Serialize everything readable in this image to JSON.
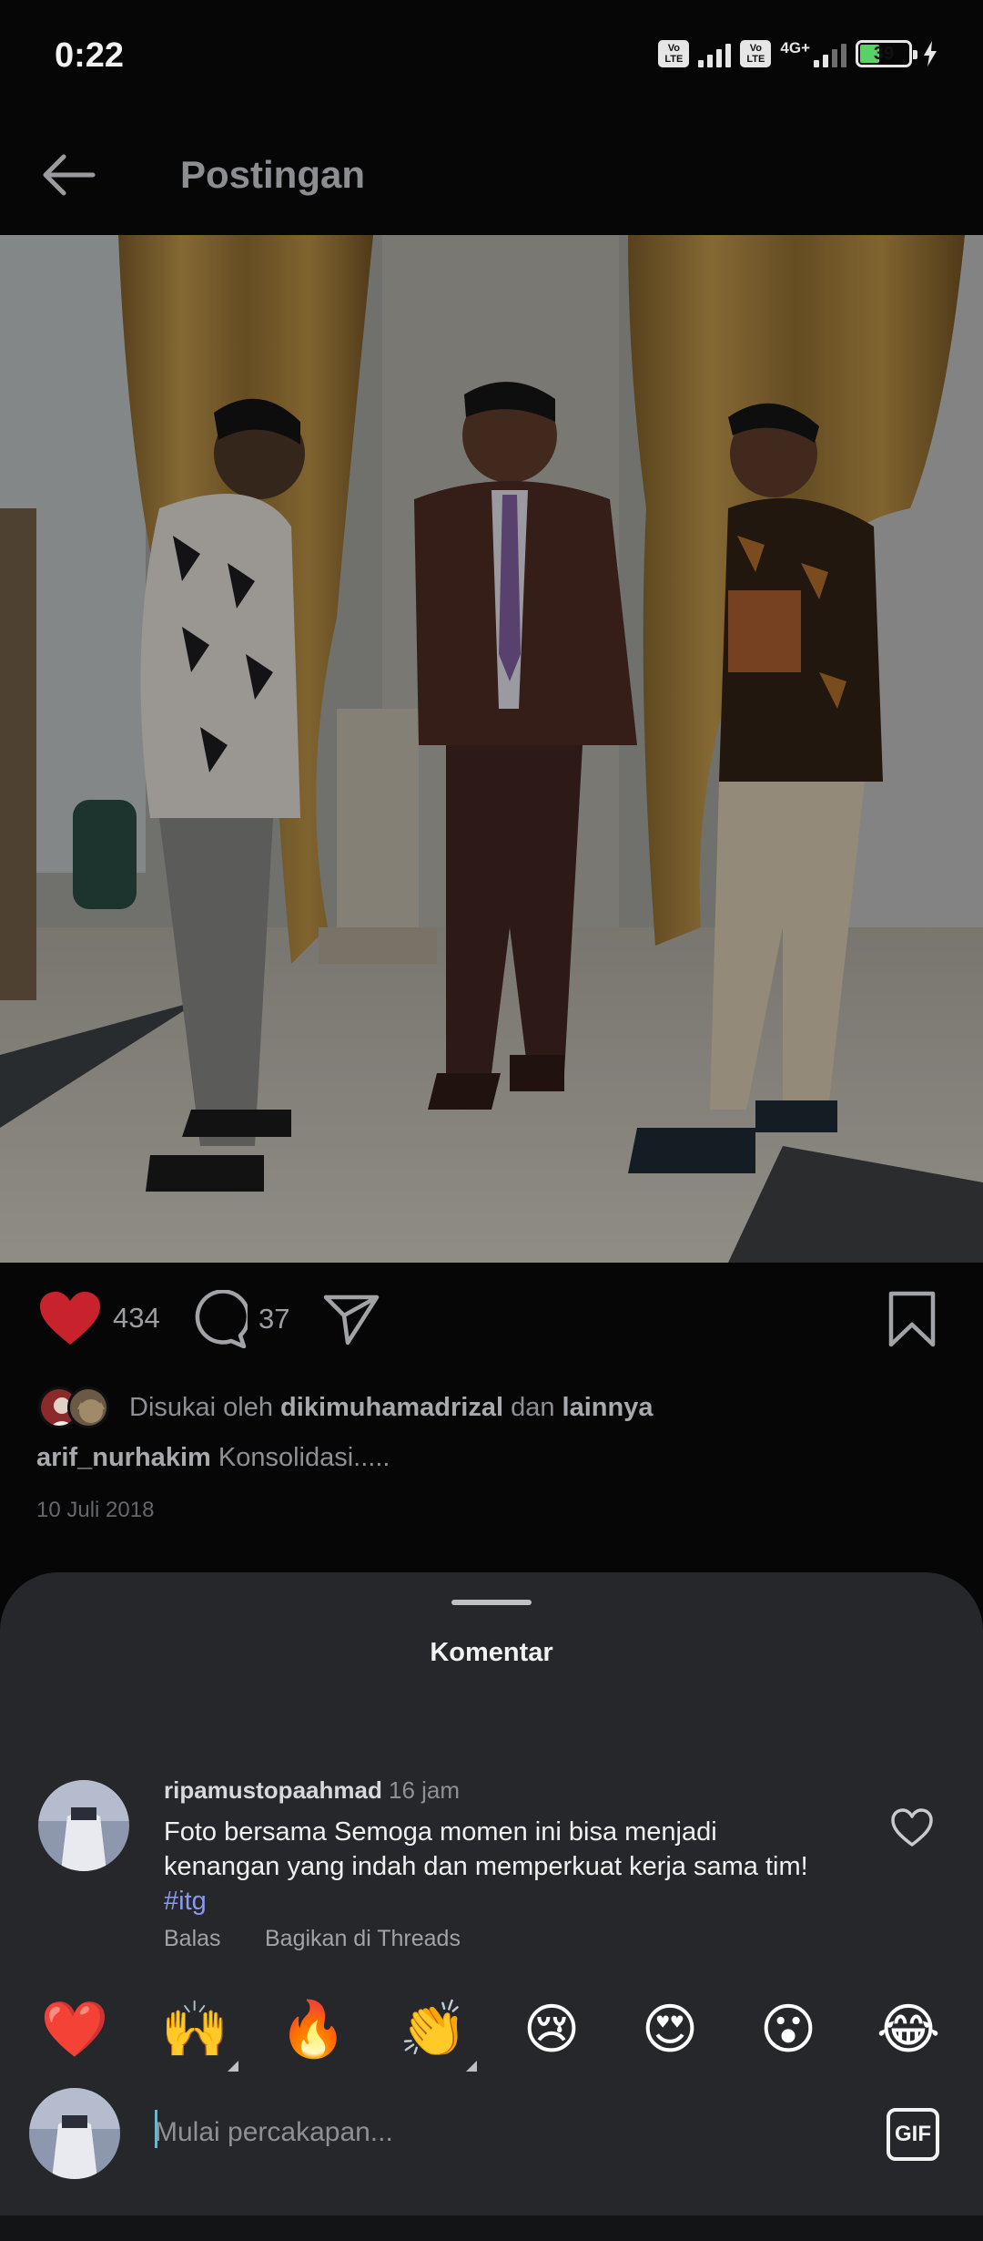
{
  "status_bar": {
    "time": "0:22",
    "volte_1": "Vo LTE",
    "volte_2": "Vo LTE",
    "network": "4G+",
    "battery": "39"
  },
  "header": {
    "title": "Postingan",
    "back_icon": "arrow-left-icon"
  },
  "post": {
    "likes_count": "434",
    "comments_count": "37",
    "liked_by_prefix": "Disukai oleh",
    "liked_by_user": "dikimuhamadrizal",
    "liked_by_middle": "dan",
    "liked_by_others": "lainnya",
    "caption_user": "arif_nurhakim",
    "caption_text": "Konsolidasi.....",
    "date": "10 Juli 2018",
    "icons": [
      "heart-filled-icon",
      "comment-icon",
      "share-icon",
      "bookmark-icon"
    ],
    "colors": {
      "like": "#c8232c"
    }
  },
  "comments_sheet": {
    "title": "Komentar",
    "comments": [
      {
        "username": "ripamustopaahmad",
        "time": "16 jam",
        "text": "Foto bersama Semoga momen ini bisa menjadi kenangan yang indah dan memperkuat kerja sama tim!",
        "hashtag": "#itg",
        "reply_label": "Balas",
        "share_label": "Bagikan di Threads"
      }
    ],
    "quick_reactions": [
      "❤️",
      "🙌",
      "🔥",
      "👏",
      "😢",
      "😍",
      "😮",
      "😂"
    ],
    "input": {
      "placeholder": "Mulai percakapan...",
      "gif_label": "GIF"
    }
  }
}
